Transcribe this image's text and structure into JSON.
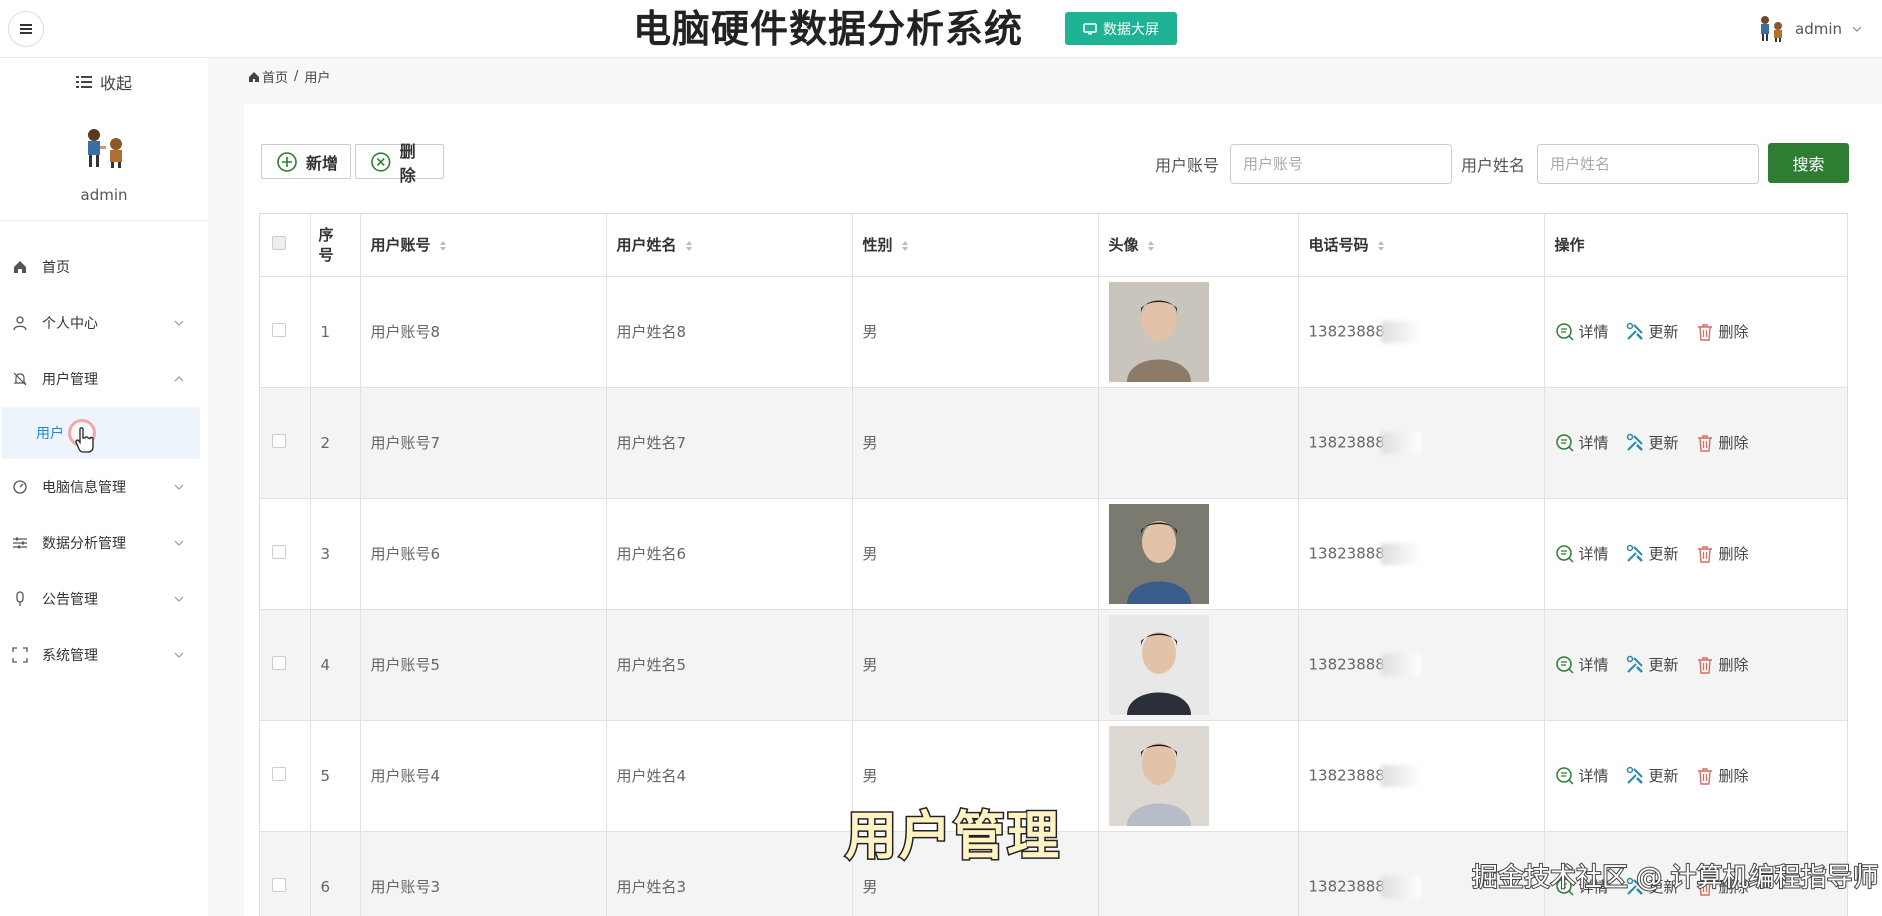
{
  "header": {
    "title": "电脑硬件数据分析系统",
    "big_screen_label": "数据大屏",
    "username": "admin"
  },
  "sidebar": {
    "collapse_label": "收起",
    "username": "admin",
    "items": [
      {
        "label": "首页",
        "icon": "home-icon"
      },
      {
        "label": "个人中心",
        "icon": "user-icon"
      },
      {
        "label": "用户管理",
        "icon": "bell-off-icon"
      },
      {
        "label": "电脑信息管理",
        "icon": "compass-icon"
      },
      {
        "label": "数据分析管理",
        "icon": "sliders-icon"
      },
      {
        "label": "公告管理",
        "icon": "microphone-icon"
      },
      {
        "label": "系统管理",
        "icon": "frame-icon"
      }
    ],
    "active_sub": "用户"
  },
  "breadcrumb": {
    "home": "首页",
    "sep": "/",
    "current": "用户"
  },
  "toolbar": {
    "add_label": "新增",
    "delete_label": "删除",
    "account_label": "用户账号",
    "account_placeholder": "用户账号",
    "name_label": "用户姓名",
    "name_placeholder": "用户姓名",
    "search_label": "搜索"
  },
  "table": {
    "columns": [
      "序号",
      "用户账号",
      "用户姓名",
      "性别",
      "头像",
      "电话号码",
      "操作"
    ],
    "actions": {
      "detail": "详情",
      "update": "更新",
      "delete": "删除"
    },
    "rows": [
      {
        "index": "1",
        "account": "用户账号8",
        "name": "用户姓名8",
        "gender": "男",
        "phone": "13823888",
        "has_avatar": true
      },
      {
        "index": "2",
        "account": "用户账号7",
        "name": "用户姓名7",
        "gender": "男",
        "phone": "13823888",
        "has_avatar": false
      },
      {
        "index": "3",
        "account": "用户账号6",
        "name": "用户姓名6",
        "gender": "男",
        "phone": "13823888",
        "has_avatar": true
      },
      {
        "index": "4",
        "account": "用户账号5",
        "name": "用户姓名5",
        "gender": "男",
        "phone": "13823888",
        "has_avatar": true
      },
      {
        "index": "5",
        "account": "用户账号4",
        "name": "用户姓名4",
        "gender": "男",
        "phone": "13823888",
        "has_avatar": true
      },
      {
        "index": "6",
        "account": "用户账号3",
        "name": "用户姓名3",
        "gender": "男",
        "phone": "13823888",
        "has_avatar": false
      }
    ]
  },
  "overlay": {
    "caption": "用户管理",
    "watermark": "掘金技术社区 @ 计算机编程指导师"
  },
  "colors": {
    "accent_green": "#1eb394",
    "search_green": "#2e7d32",
    "active_blue": "#1a8ad4"
  }
}
